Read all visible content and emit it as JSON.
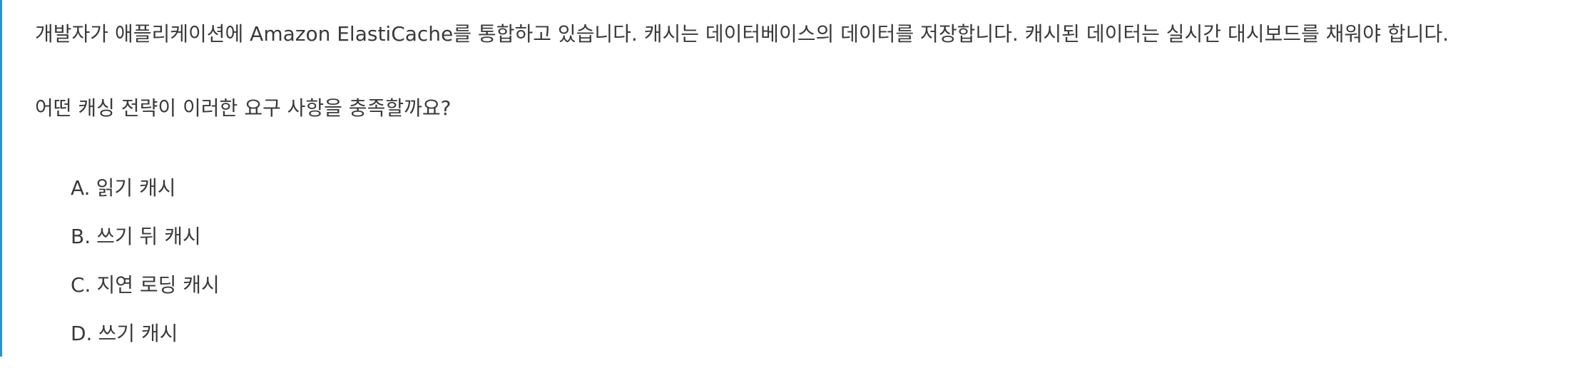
{
  "question": {
    "text": "개발자가 애플리케이션에 Amazon ElastiCache를 통합하고 있습니다. 캐시는 데이터베이스의 데이터를 저장합니다. 캐시된 데이터는 실시간 대시보드를 채워야 합니다.",
    "prompt": "어떤 캐싱 전략이 이러한 요구 사항을 충족할까요?"
  },
  "options": [
    {
      "letter": "A.",
      "text": "읽기 캐시"
    },
    {
      "letter": "B.",
      "text": "쓰기 뒤 캐시"
    },
    {
      "letter": "C.",
      "text": "지연 로딩 캐시"
    },
    {
      "letter": "D.",
      "text": "쓰기 캐시"
    }
  ],
  "colors": {
    "accent_border": "#2f8fd0",
    "text": "#3a3a3a",
    "background": "#ffffff"
  }
}
